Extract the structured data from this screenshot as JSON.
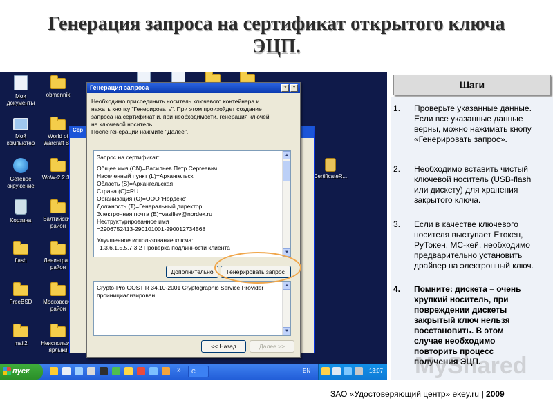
{
  "slide": {
    "title_line1": "Генерация запроса на сертификат открытого ключа",
    "title_line2": "ЭЦП.",
    "footer_company": "ЗАО «Удостоверяющий центр» ekey.ru",
    "footer_sep": "|",
    "footer_year": "2009",
    "watermark": "MyShared"
  },
  "desktop": {
    "icons": [
      {
        "label": "Мои документы",
        "icon": "my-documents-icon"
      },
      {
        "label": "Мой компьютер",
        "icon": "my-computer-icon"
      },
      {
        "label": "Сетевое окружение",
        "icon": "network-icon"
      },
      {
        "label": "Корзина",
        "icon": "recycle-bin-icon"
      },
      {
        "label": "flash",
        "icon": "folder-icon"
      },
      {
        "label": "FreeBSD",
        "icon": "folder-icon"
      },
      {
        "label": "mail2",
        "icon": "folder-icon"
      },
      {
        "label": "obmennik",
        "icon": "folder-icon"
      },
      {
        "label": "World of Warcraft BK",
        "icon": "folder-icon"
      },
      {
        "label": "WoW-2.2.3...",
        "icon": "folder-icon"
      },
      {
        "label": "Балтийский район",
        "icon": "folder-icon"
      },
      {
        "label": "Ленингра... район",
        "icon": "folder-icon"
      },
      {
        "label": "Московский район",
        "icon": "folder-icon"
      },
      {
        "label": "Неиспользу... ярлыки",
        "icon": "folder-icon"
      },
      {
        "label": "CertificateR...",
        "icon": "certificate-lock-icon"
      }
    ],
    "bg_window_title": "Сер"
  },
  "dialog": {
    "title": "Генерация запроса",
    "help_glyph": "?",
    "close_glyph": "×",
    "intro": [
      "Необходимо присоединить носитель ключевого контейнера и",
      "нажать кнопку \"Генерировать\". При этом произойдет создание",
      "запроса на сертификат и, при необходимости, генерация ключей",
      "на ключевой носитель.",
      "После генерации нажмите \"Далее\"."
    ],
    "request_header": "Запрос на сертификат:",
    "request_lines": [
      "Общее имя (CN)=Васильев Петр Сергеевич",
      "Населенный пункт (L)=Архангельск",
      "Область (S)=Архангельская",
      "Страна (C)=RU",
      "Организация (O)=ООО 'Нордекс'",
      "Должность (T)=Генеральный директор",
      "Электронная почта (E)=vasiliev@nordex.ru",
      "Неструктурированное имя",
      "=2906752413-290101001-290012734568"
    ],
    "key_usage_header": "Улучшенное использование ключа:",
    "key_usage_value": "1.3.6.1.5.5.7.3.2 Проверка подлинности клиента",
    "btn_advanced": "Дополнительно",
    "btn_generate": "Генерировать запрос",
    "status_lines": [
      "Crypto-Pro GOST R 34.10-2001 Cryptographic Service Provider",
      "проинициализирован."
    ],
    "btn_back": "<< Назад",
    "btn_next": "Далее >>"
  },
  "taskbar": {
    "start_label": "пуск",
    "chevron": "»",
    "task_label": "С",
    "lang": "EN",
    "clock": "13:07"
  },
  "steps": {
    "header": "Шаги",
    "items": [
      {
        "num": "1.",
        "lines": [
          "Проверьте указанные данные.",
          "Если все указанные данные",
          "верны, можно нажимать кнопу",
          "«Генерировать запрос»."
        ]
      },
      {
        "num": "2.",
        "lines": [
          "Необходимо вставить чистый",
          "ключевой носитель (USB-flash",
          "или дискету) для хранения",
          "закрытого ключа."
        ]
      },
      {
        "num": "3.",
        "lines": [
          "Если в качестве ключевого",
          "носителя выступает Етокен,",
          "РуТокен, МС-кей, необходимо",
          "предварительно установить",
          "драйвер на электронный ключ."
        ]
      },
      {
        "num": "4.",
        "lines": [
          "Помните: дискета – очень",
          "хрупкий носитель, при",
          "повреждении дискеты",
          "закрытый ключ нельзя",
          "восстановить. В этом",
          "случае необходимо",
          "повторить процесс",
          "получения ЭЦП."
        ]
      }
    ]
  }
}
